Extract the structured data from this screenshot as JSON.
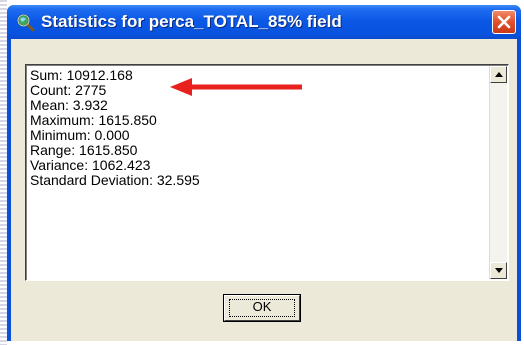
{
  "window": {
    "title": "Statistics for perca_TOTAL_85% field",
    "app_icon": "magnifier-globe-icon",
    "close_icon": "close-icon"
  },
  "statistics": {
    "lines": [
      "Sum: 10912.168",
      "Count: 2775",
      "Mean: 3.932",
      "Maximum: 1615.850",
      "Minimum: 0.000",
      "Range: 1615.850",
      "Variance: 1062.423",
      "Standard Deviation: 32.595"
    ]
  },
  "buttons": {
    "ok_label": "OK"
  },
  "annotation": {
    "arrow_color": "#e8211c",
    "points_to": "Count: 2775"
  },
  "colors": {
    "titlebar": "#0854e0",
    "client_background": "#ece9d8",
    "close_button": "#e2502c"
  }
}
